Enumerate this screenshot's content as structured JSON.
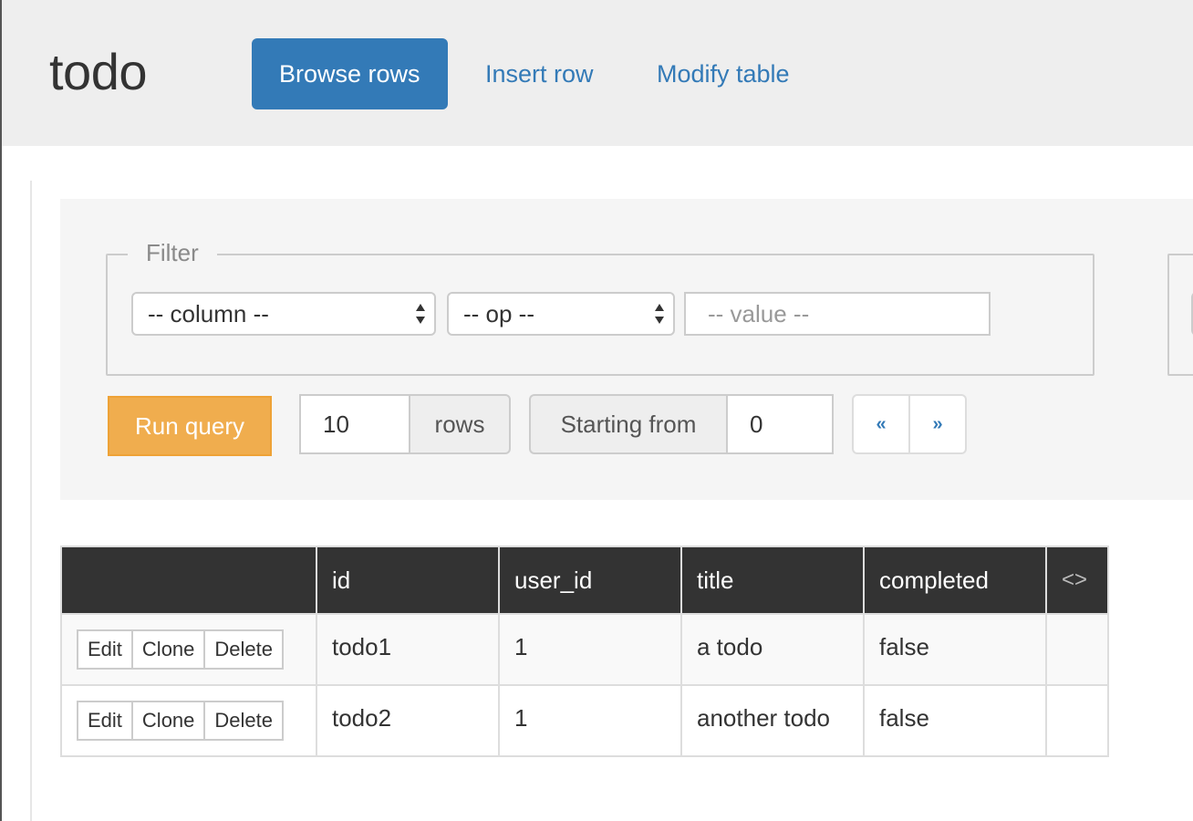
{
  "header": {
    "table_name": "todo",
    "nav": [
      {
        "label": "Browse rows",
        "active": true
      },
      {
        "label": "Insert row",
        "active": false
      },
      {
        "label": "Modify table",
        "active": false
      }
    ]
  },
  "filter": {
    "legend": "Filter",
    "column_select": "-- column --",
    "op_select": "-- op --",
    "value_placeholder": "-- value --"
  },
  "query": {
    "run_label": "Run query",
    "limit_value": "10",
    "limit_addon": "rows",
    "offset_addon": "Starting from",
    "offset_value": "0",
    "prev_label": "«",
    "next_label": "»"
  },
  "results": {
    "columns": [
      "",
      "id",
      "user_id",
      "title",
      "completed",
      "<>"
    ],
    "row_actions": [
      "Edit",
      "Clone",
      "Delete"
    ],
    "rows": [
      {
        "id": "todo1",
        "user_id": "1",
        "title": "a todo",
        "completed": "false"
      },
      {
        "id": "todo2",
        "user_id": "1",
        "title": "another todo",
        "completed": "false"
      }
    ]
  },
  "colors": {
    "primary": "#337ab7",
    "warning": "#f0ad4e",
    "header_bg": "#eeeeee",
    "table_head_bg": "#333333"
  }
}
